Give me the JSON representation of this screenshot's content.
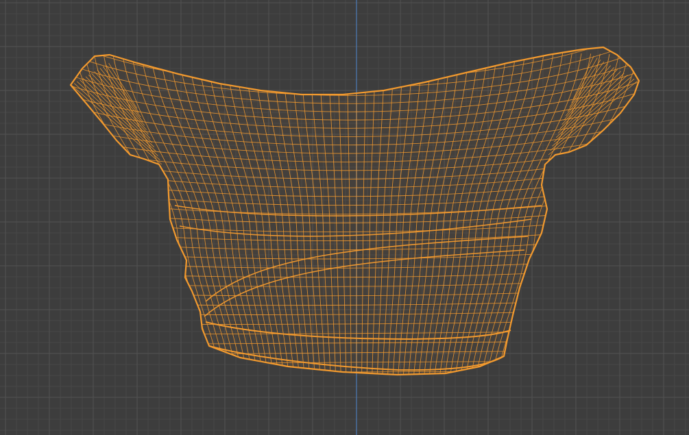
{
  "viewport": {
    "mode": "wireframe",
    "background_color": "#3d3d3d",
    "grid_color_minor": "#474747",
    "grid_color_major": "#525252",
    "axis_color": "#4d7bb8",
    "axis_name": "y-axis",
    "mesh_color": "#f39a2e",
    "mesh_shape": "saddle-like torso mesh",
    "icon": "mesh-wireframe-icon"
  }
}
